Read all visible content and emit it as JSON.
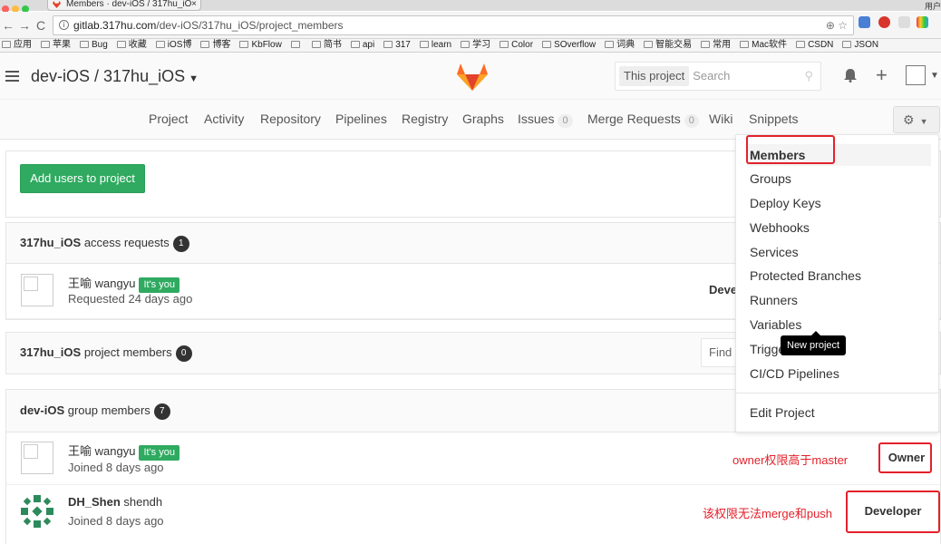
{
  "browser": {
    "tab_title": "Members · dev-iOS / 317hu_iO",
    "tab_close": "×",
    "user_label": "用户",
    "url_host": "gitlab.317hu.com",
    "url_path": "/dev-iOS/317hu_iOS/project_members",
    "bookmarks": [
      "应用",
      "苹果",
      "Bug",
      "收藏",
      "iOS博",
      "博客",
      "KbFlow",
      "",
      "简书",
      "api",
      "317",
      "learn",
      "学习",
      "Color",
      "SOverflow",
      "词典",
      "智能交易",
      "常用",
      "Mac软件",
      "CSDN",
      "JSON"
    ]
  },
  "header": {
    "project_title": "dev-iOS / 317hu_iOS",
    "search_scope": "This project",
    "search_placeholder": "Search"
  },
  "subnav": {
    "items": [
      "Project",
      "Activity",
      "Repository",
      "Pipelines",
      "Registry",
      "Graphs",
      "Issues",
      "Merge Requests",
      "Wiki",
      "Snippets"
    ],
    "issues_count": "0",
    "mr_count": "0"
  },
  "content": {
    "add_users_button": "Add users to project",
    "access_requests": {
      "project": "317hu_iOS",
      "label": "access requests",
      "count": "1"
    },
    "request_row": {
      "name": "王喻",
      "username": "wangyu",
      "you_badge": "It's you",
      "sub": "Requested 24 days ago",
      "access_partial": "Deve"
    },
    "project_members": {
      "project": "317hu_iOS",
      "label": "project members",
      "count": "0",
      "find_placeholder": "Find"
    },
    "group_members": {
      "group": "dev-iOS",
      "label": "group members",
      "count": "7"
    },
    "member1": {
      "name": "王喻",
      "username": "wangyu",
      "you_badge": "It's you",
      "sub": "Joined 8 days ago",
      "role": "Owner",
      "note": "owner权限高于master"
    },
    "member2": {
      "name": "DH_Shen",
      "username": "shendh",
      "sub": "Joined 8 days ago",
      "role": "Developer",
      "note": "该权限无法merge和push"
    }
  },
  "settings_menu": {
    "items": [
      "Members",
      "Groups",
      "Deploy Keys",
      "Webhooks",
      "Services",
      "Protected Branches",
      "Runners",
      "Variables",
      "Triggers",
      "CI/CD Pipelines"
    ],
    "edit_project": "Edit Project",
    "tooltip": "New project"
  },
  "colors": {
    "accent_green": "#2faa60",
    "annotation_red": "#e3212b",
    "gitlab_orange": "#e24329"
  }
}
